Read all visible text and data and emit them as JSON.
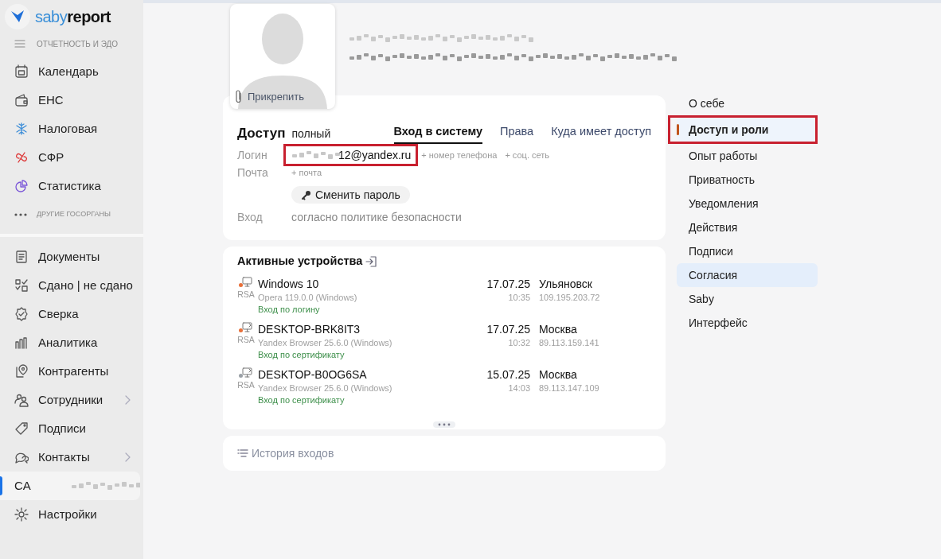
{
  "app": {
    "logo_prefix": "saby",
    "logo_suffix": "report"
  },
  "sidebar": {
    "section_label": "ОТЧЕТНОСТЬ И ЭДО",
    "gov_items": [
      {
        "label": "Календарь"
      },
      {
        "label": "ЕНС"
      },
      {
        "label": "Налоговая"
      },
      {
        "label": "СФР"
      },
      {
        "label": "Статистика"
      }
    ],
    "more_label": "ДРУГИЕ ГОСОРГАНЫ",
    "items": [
      {
        "kind": "nav",
        "label": "Документы",
        "expandable": false,
        "selected": false
      },
      {
        "kind": "nav",
        "label": "Сдано | не сдано",
        "expandable": false,
        "selected": false
      },
      {
        "kind": "nav",
        "label": "Сверка",
        "expandable": false,
        "selected": false
      },
      {
        "kind": "nav",
        "label": "Аналитика",
        "expandable": false,
        "selected": false
      },
      {
        "kind": "nav",
        "label": "Контрагенты",
        "expandable": false,
        "selected": false
      },
      {
        "kind": "nav",
        "label": "Сотрудники",
        "expandable": true,
        "selected": false
      },
      {
        "kind": "nav",
        "label": "Подписи",
        "expandable": false,
        "selected": false
      },
      {
        "kind": "nav",
        "label": "Контакты",
        "expandable": true,
        "selected": false
      },
      {
        "kind": "user",
        "label": "CA",
        "expandable": false,
        "selected": true
      },
      {
        "kind": "nav",
        "label": "Настройки",
        "expandable": false,
        "selected": false
      }
    ]
  },
  "profile": {
    "attach_label": "Прикрепить"
  },
  "access": {
    "title": "Доступ",
    "level": "полный",
    "tabs": [
      {
        "label": "Вход в систему",
        "selected": true
      },
      {
        "label": "Права",
        "selected": false
      },
      {
        "label": "Куда имеет доступ",
        "selected": false
      }
    ],
    "login_label": "Логин",
    "login_value": "12@yandex.ru",
    "login_annotated": true,
    "add_links": [
      "+ номер телефона",
      "+ соц. сеть"
    ],
    "mail_label": "Почта",
    "mail_add": "+ почта",
    "password_button": "Сменить пароль",
    "entry_label": "Вход",
    "entry_value": "согласно политике безопасности"
  },
  "devices": {
    "title": "Активные устройства",
    "items": [
      {
        "kind": "local",
        "color": "#e8703a",
        "badge": "RSA",
        "name": "Windows 10",
        "browser": "Opera 119.0.0 (Windows)",
        "method": "Вход по логину",
        "date": "17.07.25",
        "time": "10:35",
        "city": "Ульяновск",
        "ip": "109.195.203.72"
      },
      {
        "kind": "remote",
        "color": "#e8703a",
        "badge": "RSA",
        "name": "DESKTOP-BRK8IT3",
        "browser": "Yandex Browser 25.6.0 (Windows)",
        "method": "Вход по сертификату",
        "date": "17.07.25",
        "time": "10:32",
        "city": "Москва",
        "ip": "89.113.159.141"
      },
      {
        "kind": "remote",
        "color": "#9aa0a6",
        "badge": "RSA",
        "name": "DESKTOP-B0OG6SA",
        "browser": "Yandex Browser 25.6.0 (Windows)",
        "method": "Вход по сертификату",
        "date": "15.07.25",
        "time": "14:03",
        "city": "Москва",
        "ip": "89.113.147.109"
      }
    ]
  },
  "history": {
    "label": "История входов"
  },
  "nav": [
    {
      "label": "О себе",
      "selected": false,
      "hovered": false,
      "annotated": false
    },
    {
      "label": "Доступ и роли",
      "selected": true,
      "hovered": false,
      "annotated": true
    },
    {
      "label": "Опыт работы",
      "selected": false,
      "hovered": false,
      "annotated": false
    },
    {
      "label": "Приватность",
      "selected": false,
      "hovered": false,
      "annotated": false
    },
    {
      "label": "Уведомления",
      "selected": false,
      "hovered": false,
      "annotated": false
    },
    {
      "label": "Действия",
      "selected": false,
      "hovered": false,
      "annotated": false
    },
    {
      "label": "Подписи",
      "selected": false,
      "hovered": false,
      "annotated": false
    },
    {
      "label": "Согласия",
      "selected": false,
      "hovered": true,
      "annotated": false
    },
    {
      "label": "Saby",
      "selected": false,
      "hovered": false,
      "annotated": false
    },
    {
      "label": "Интерфейс",
      "selected": false,
      "hovered": false,
      "annotated": false
    }
  ]
}
